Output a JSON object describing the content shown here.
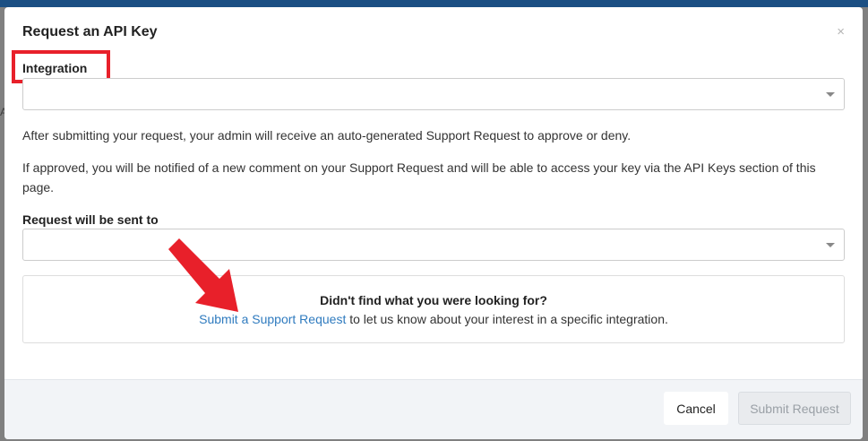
{
  "background": {
    "edge_letter": "A"
  },
  "modal": {
    "title": "Request an API Key",
    "close_symbol": "×"
  },
  "integration": {
    "label": "Integration",
    "selected_value": ""
  },
  "paragraphs": {
    "p1": "After submitting your request, your admin will receive an auto-generated Support Request to approve or deny.",
    "p2": "If approved, you will be notified of a new comment on your Support Request and will be able to access your key via the API Keys section of this page."
  },
  "recipient": {
    "label": "Request will be sent to",
    "selected_value": ""
  },
  "info": {
    "title": "Didn't find what you were looking for?",
    "link_text": "Submit a Support Request",
    "suffix_text": " to let us know about your interest in a specific integration."
  },
  "footer": {
    "cancel_label": "Cancel",
    "submit_label": "Submit Request"
  },
  "colors": {
    "highlight_red": "#e8202a",
    "link_blue": "#2f7bbf",
    "top_bar_blue": "#1b4f83"
  },
  "icons": {
    "close": "close-icon",
    "caret": "chevron-down-icon",
    "annotation_arrow": "arrow-icon"
  }
}
